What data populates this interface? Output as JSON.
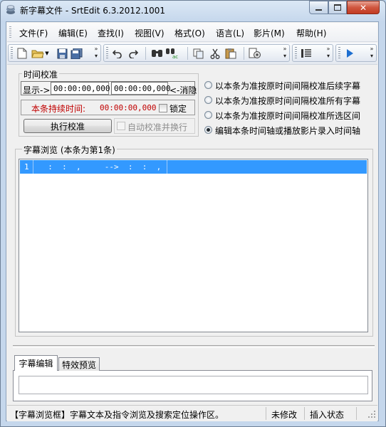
{
  "window": {
    "title": "新字幕文件 - SrtEdit 6.3.2012.1001"
  },
  "menu": [
    {
      "label": "文件(F)"
    },
    {
      "label": "编辑(E)"
    },
    {
      "label": "查找(I)"
    },
    {
      "label": "视图(V)"
    },
    {
      "label": "格式(O)"
    },
    {
      "label": "语言(L)"
    },
    {
      "label": "影片(M)"
    },
    {
      "label": "帮助(H)"
    }
  ],
  "toolbar": {
    "icons": [
      "new-file-icon",
      "open-folder-icon",
      "save-icon",
      "save-all-icon",
      "undo-icon",
      "redo-icon",
      "find-icon",
      "replace-icon",
      "copy-icon",
      "cut-icon",
      "paste-icon",
      "settings-icon",
      "list-view-icon",
      "play-icon"
    ]
  },
  "time_calibration": {
    "group_label": "时间校准",
    "display_label": "显示->",
    "start_time": "00:00:00,000",
    "end_time": "00:00:00,000",
    "hide_label": "<-消隐",
    "duration_label": "本条持续时间:",
    "duration_value": "00:00:00,000",
    "lock_label": "锁定",
    "execute_button": "执行校准",
    "auto_label": "自动校准并换行",
    "options": [
      {
        "label": "以本条为准按原时间间隔校准后续字幕",
        "selected": false
      },
      {
        "label": "以本条为准按原时间间隔校准所有字幕",
        "selected": false
      },
      {
        "label": "以本条为准按原时间间隔校准所选区间",
        "selected": false
      },
      {
        "label": "编辑本条时间轴或播放影片录入时间轴",
        "selected": true
      }
    ]
  },
  "browser": {
    "group_label": "字幕浏览 (本条为第1条)",
    "rows": [
      {
        "index": "1",
        "content": "  :  :  ,     -->  :  :  ,"
      }
    ]
  },
  "editor": {
    "tabs": [
      {
        "label": "字幕编辑",
        "active": true
      },
      {
        "label": "特效预览",
        "active": false
      }
    ],
    "text": ""
  },
  "status": {
    "hint": "【字幕浏览框】字幕文本及指令浏览及搜索定位操作区。",
    "modified": "未修改",
    "mode": "插入状态"
  },
  "colors": {
    "selection": "#3399ff",
    "duration_label": "#c00000",
    "close_button": "#c13b22"
  }
}
